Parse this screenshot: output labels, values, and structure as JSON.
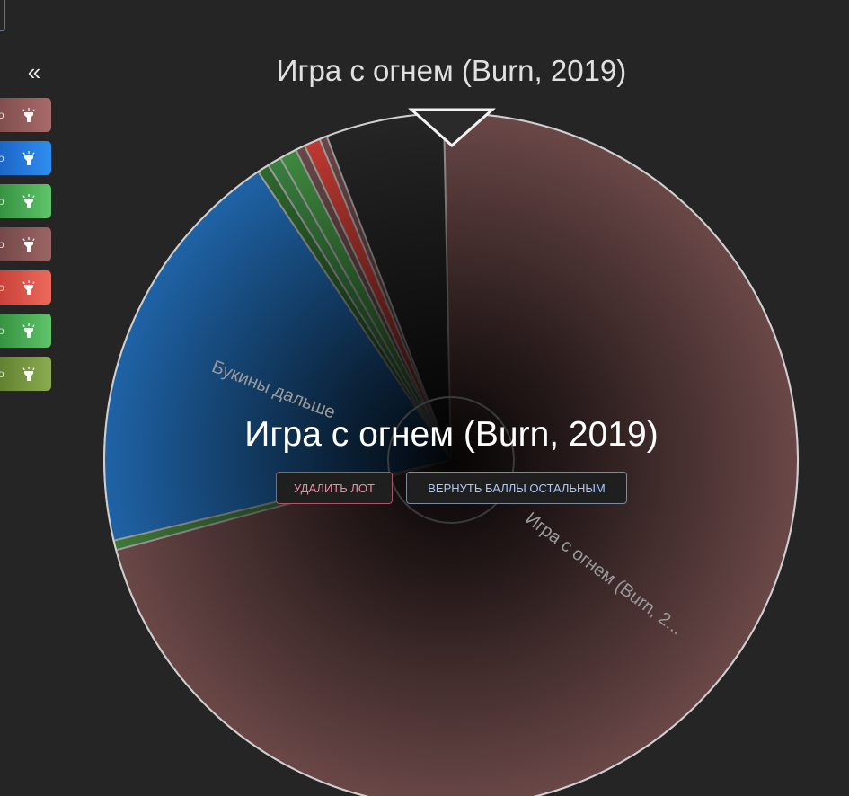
{
  "wheel": {
    "title": "Игра с огнем (Burn, 2019)",
    "winner": "Игра с огнем (Burn, 2019)",
    "slices": [
      {
        "label": "Игра с огнем (Burn, 2...",
        "color": "#6b4848",
        "fraction": 0.7115
      },
      {
        "label": "",
        "color": "#3f7a3a",
        "fraction": 0.0045
      },
      {
        "label": "Букины дальше",
        "color": "#1f64a8",
        "fraction": 0.1935
      },
      {
        "label": "",
        "color": "#2e6a2e",
        "fraction": 0.0055
      },
      {
        "label": "",
        "color": "#3a8040",
        "fraction": 0.0065
      },
      {
        "label": "",
        "color": "#3f8a3f",
        "fraction": 0.008
      },
      {
        "label": "",
        "color": "#6b4848",
        "fraction": 0.0045
      },
      {
        "label": "",
        "color": "#c03a32",
        "fraction": 0.0075
      },
      {
        "label": "",
        "color": "#6b4848",
        "fraction": 0.0035
      }
    ]
  },
  "actions": {
    "remove_label": "УДАЛИТЬ ЛОТ",
    "return_label": "ВЕРНУТЬ БАЛЛЫ ОСТАЛЬНЫМ"
  },
  "sidebar": {
    "collapse_label": "«",
    "lots": [
      {
        "fragment": "о",
        "gradient": [
          "#7a4a4a",
          "#a96a6a"
        ]
      },
      {
        "fragment": "о",
        "gradient": [
          "#1a5fc0",
          "#2e8ef0"
        ]
      },
      {
        "fragment": "о",
        "gradient": [
          "#2f8a3a",
          "#5fc46a"
        ]
      },
      {
        "fragment": "о",
        "gradient": [
          "#6e4444",
          "#9c6565"
        ]
      },
      {
        "fragment": "о",
        "gradient": [
          "#c23c34",
          "#ec6a5c"
        ]
      },
      {
        "fragment": "о",
        "gradient": [
          "#2f8a3a",
          "#5fc46a"
        ]
      },
      {
        "fragment": "о",
        "gradient": [
          "#5a7a2c",
          "#8cac50"
        ]
      }
    ]
  }
}
